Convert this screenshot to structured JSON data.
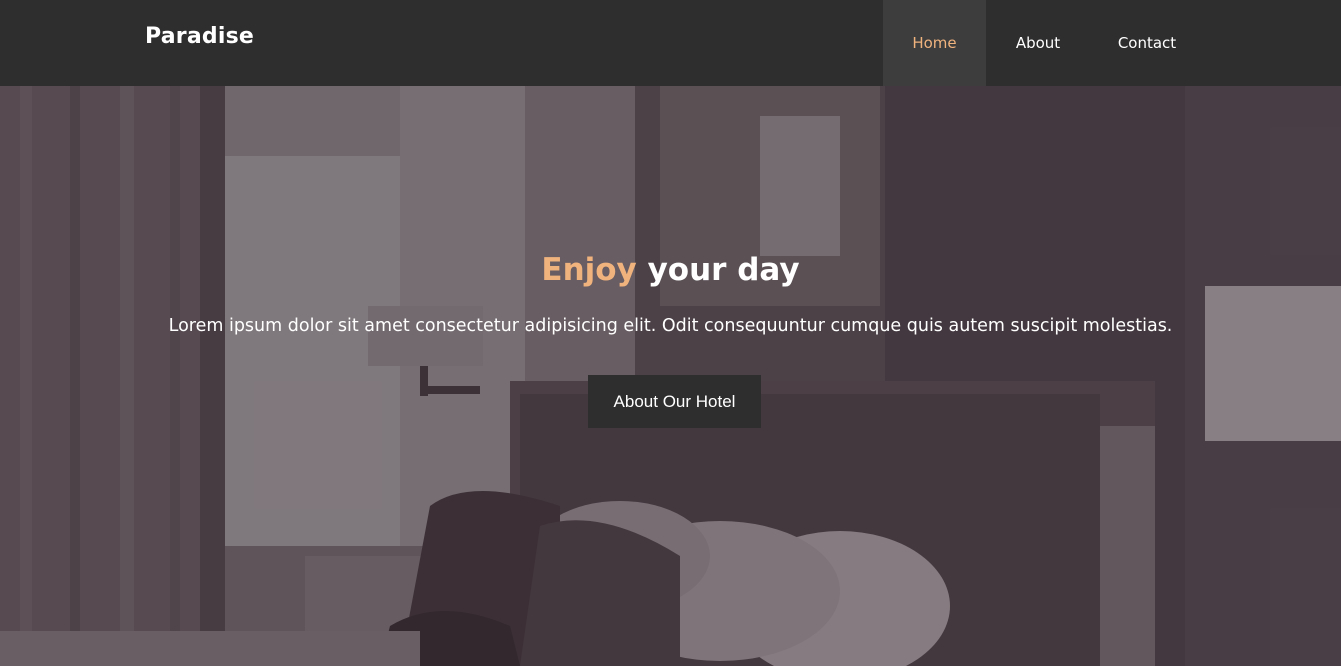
{
  "navbar": {
    "brand": "Paradise",
    "items": [
      {
        "label": "Home",
        "active": true
      },
      {
        "label": "About",
        "active": false
      },
      {
        "label": "Contact",
        "active": false
      }
    ]
  },
  "hero": {
    "headline_accent": "Enjoy",
    "headline_rest": "your day",
    "subtext": "Lorem ipsum dolor sit amet consectetur adipisicing elit. Odit consequuntur cumque quis autem suscipit molestias.",
    "cta_label": "About Our Hotel",
    "background_image": "hotel-bedroom-photo"
  },
  "colors": {
    "accent": "#f0b37e",
    "navbar": "#2e2e2e",
    "active_nav": "#3d3d3d",
    "overlay": "#3a2c36"
  }
}
